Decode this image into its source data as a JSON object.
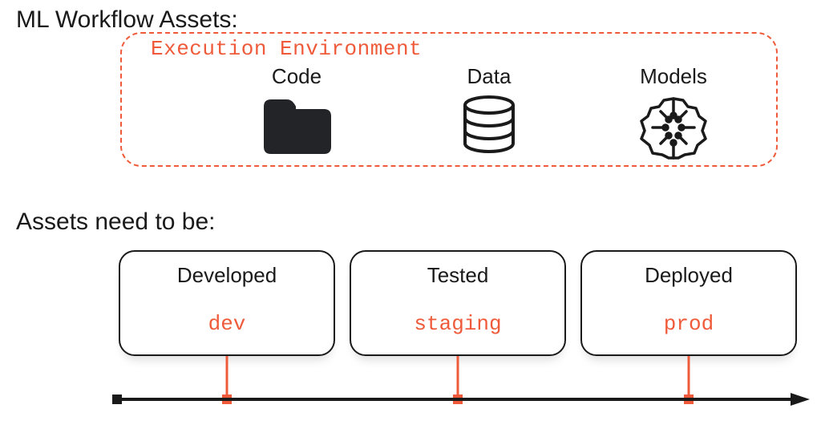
{
  "headings": {
    "top": "ML Workflow Assets:",
    "bottom": "Assets need to be:"
  },
  "environment_label": "Execution Environment",
  "assets": {
    "code": "Code",
    "data": "Data",
    "models": "Models"
  },
  "stages": [
    {
      "title": "Developed",
      "env": "dev"
    },
    {
      "title": "Tested",
      "env": "staging"
    },
    {
      "title": "Deployed",
      "env": "prod"
    }
  ],
  "colors": {
    "accent": "#ef5b3a",
    "ink": "#1a1a1a"
  }
}
